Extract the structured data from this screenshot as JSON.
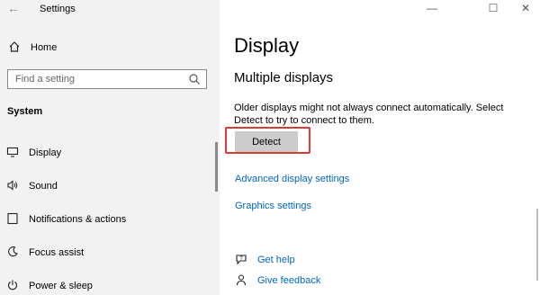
{
  "window": {
    "title": "Settings",
    "back_icon": "←",
    "minimize_icon": "—",
    "maximize_icon": "☐",
    "close_icon": "✕"
  },
  "sidebar": {
    "home_label": "Home",
    "search_placeholder": "Find a setting",
    "section_label": "System",
    "items": [
      {
        "label": "Display",
        "icon": "display-icon"
      },
      {
        "label": "Sound",
        "icon": "sound-icon"
      },
      {
        "label": "Notifications & actions",
        "icon": "notifications-icon"
      },
      {
        "label": "Focus assist",
        "icon": "focus-assist-icon"
      },
      {
        "label": "Power & sleep",
        "icon": "power-icon"
      }
    ]
  },
  "main": {
    "page_title": "Display",
    "section_title": "Multiple displays",
    "description": "Older displays might not always connect automatically. Select Detect to try to connect to them.",
    "detect_label": "Detect",
    "links": {
      "advanced": "Advanced display settings",
      "graphics": "Graphics settings"
    },
    "help": {
      "get_help": "Get help",
      "give_feedback": "Give feedback"
    }
  },
  "colors": {
    "accent": "#0067c0",
    "highlight": "#d93b3b",
    "sidebar_bg": "#f2f2f2",
    "button_bg": "#cccccc"
  }
}
